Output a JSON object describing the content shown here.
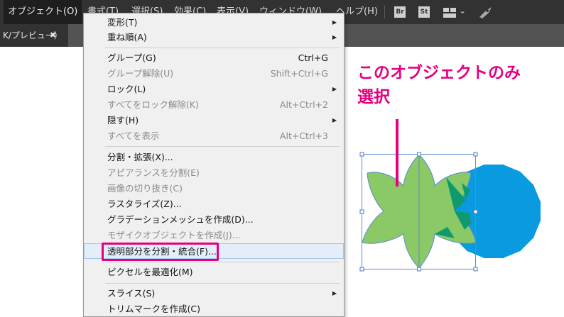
{
  "menubar": {
    "items": [
      {
        "label": "オブジェクト(O)",
        "active": true
      },
      {
        "label": "書式(T)"
      },
      {
        "label": "選択(S)"
      },
      {
        "label": "効果(C)"
      },
      {
        "label": "表示(V)"
      },
      {
        "label": "ウィンドウ(W)"
      },
      {
        "label": "ヘルプ(H)"
      }
    ],
    "icons": {
      "bridge": "Br",
      "stock": "St",
      "workspace": "workspace-icon",
      "chevron": "⌄",
      "gpu": "rocket-icon"
    }
  },
  "document_tab": {
    "title": "K/プレビュー）",
    "close": "✖"
  },
  "menu": {
    "items": [
      {
        "label": "変形(T)",
        "submenu": true
      },
      {
        "label": "重ね順(A)",
        "submenu": true
      },
      {
        "label": "グループ(G)",
        "shortcut": "Ctrl+G"
      },
      {
        "label": "グループ解除(U)",
        "shortcut": "Shift+Ctrl+G",
        "disabled": true
      },
      {
        "label": "ロック(L)",
        "submenu": true
      },
      {
        "label": "すべてをロック解除(K)",
        "shortcut": "Alt+Ctrl+2",
        "disabled": true
      },
      {
        "label": "隠す(H)",
        "submenu": true
      },
      {
        "label": "すべてを表示",
        "shortcut": "Alt+Ctrl+3",
        "disabled": true
      },
      {
        "label": "分割・拡張(X)..."
      },
      {
        "label": "アピアランスを分割(E)",
        "disabled": true
      },
      {
        "label": "画像の切り抜き(C)",
        "disabled": true
      },
      {
        "label": "ラスタライズ(Z)..."
      },
      {
        "label": "グラデーションメッシュを作成(D)..."
      },
      {
        "label": "モザイクオブジェクトを作成(J)...",
        "disabled": true
      },
      {
        "label": "透明部分を分割・統合(F)...",
        "highlighted": true
      },
      {
        "label": "ピクセルを最適化(M)"
      },
      {
        "label": "スライス(S)",
        "submenu": true
      },
      {
        "label": "トリムマークを作成(C)"
      }
    ]
  },
  "annotation": {
    "text_line1": "このオブジェクトのみ",
    "text_line2": "選択"
  },
  "artwork": {
    "green_star_color": "#8bc866",
    "blue_sun_color": "#0a9ae0",
    "overlap_color": "#0e9a6e",
    "annotation_color": "#e4007f"
  }
}
